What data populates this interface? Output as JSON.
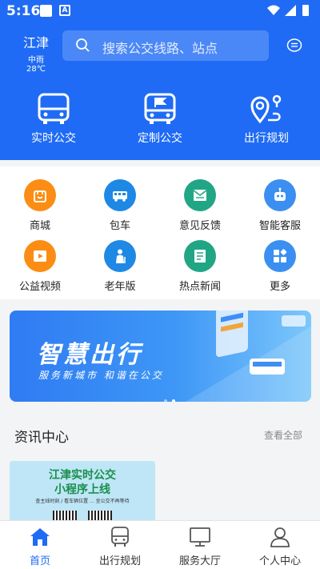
{
  "status_bar": {
    "time": "5:16",
    "notif_letter": "A"
  },
  "header": {
    "city": "江津",
    "weather": "中雨 28℃",
    "search_placeholder": "搜索公交线路、站点",
    "accent_color": "#1f6bf5"
  },
  "hero": [
    {
      "label": "实时公交",
      "icon": "bus-front-icon"
    },
    {
      "label": "定制公交",
      "icon": "custom-bus-icon"
    },
    {
      "label": "出行规划",
      "icon": "route-pin-icon"
    }
  ],
  "services": [
    {
      "label": "商城",
      "icon": "shopping-bag-icon",
      "color": "#fb8d14"
    },
    {
      "label": "包车",
      "icon": "charter-bus-icon",
      "color": "#1e88e5"
    },
    {
      "label": "意见反馈",
      "icon": "feedback-mail-icon",
      "color": "#21a685"
    },
    {
      "label": "智能客服",
      "icon": "robot-icon",
      "color": "#3b8ff0"
    },
    {
      "label": "公益视频",
      "icon": "video-play-icon",
      "color": "#fb8d14"
    },
    {
      "label": "老年版",
      "icon": "elder-icon",
      "color": "#1e88e5"
    },
    {
      "label": "热点新闻",
      "icon": "news-icon",
      "color": "#21a685"
    },
    {
      "label": "更多",
      "icon": "more-apps-icon",
      "color": "#3b8ff0"
    }
  ],
  "banner": {
    "title": "智慧出行",
    "subtitle": "服务新城市 和谐在公交",
    "dots_count": 2,
    "active_dot": 2
  },
  "news": {
    "heading": "资讯中心",
    "view_all": "查看全部",
    "card": {
      "line1": "江津实时公交",
      "line2": "小程序上线",
      "line3": "查主线时刻 / 看车辆位置 ... 坐公交不再等待"
    }
  },
  "tabbar": [
    {
      "label": "首页",
      "icon": "home-icon",
      "active": true
    },
    {
      "label": "出行规划",
      "icon": "bus-icon",
      "active": false
    },
    {
      "label": "服务大厅",
      "icon": "monitor-icon",
      "active": false
    },
    {
      "label": "个人中心",
      "icon": "person-icon",
      "active": false
    }
  ]
}
